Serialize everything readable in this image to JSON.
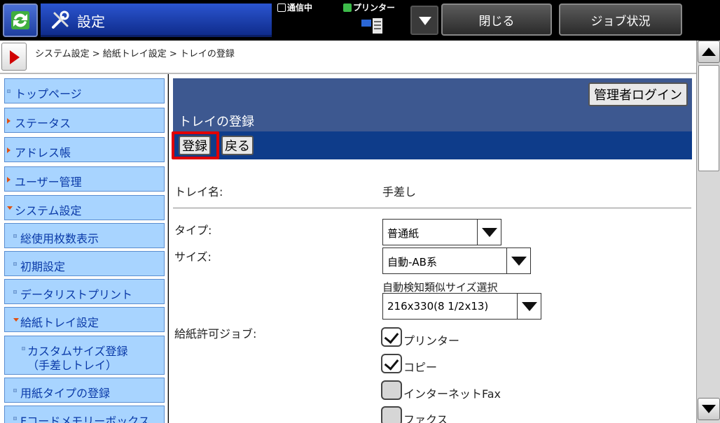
{
  "header": {
    "title": "設定",
    "status_comm": "通信中",
    "status_printer": "プリンター",
    "close_label": "閉じる",
    "job_status_label": "ジョブ状況"
  },
  "breadcrumb": "システム設定 > 給紙トレイ設定 > トレイの登録",
  "sidebar": {
    "items": [
      {
        "label": "トップページ"
      },
      {
        "label": "ステータス"
      },
      {
        "label": "アドレス帳"
      },
      {
        "label": "ユーザー管理"
      },
      {
        "label": "システム設定"
      },
      {
        "label": "総使用枚数表示"
      },
      {
        "label": "初期設定"
      },
      {
        "label": "データリストプリント"
      },
      {
        "label": "給紙トレイ設定"
      },
      {
        "label": "カスタムサイズ登録",
        "label2": "（手差しトレイ）"
      },
      {
        "label": "用紙タイプの登録"
      },
      {
        "label": "Fコードメモリーボックス"
      }
    ]
  },
  "panel": {
    "admin_login": "管理者ログイン",
    "title": "トレイの登録",
    "register": "登録",
    "back": "戻る"
  },
  "form": {
    "tray_name_label": "トレイ名:",
    "tray_name_value": "手差し",
    "type_label": "タイプ:",
    "type_value": "普通紙",
    "size_label": "サイズ:",
    "size_value": "自動-AB系",
    "auto_detect_label": "自動検知類似サイズ選択",
    "auto_detect_value": "216x330(8 1/2x13)",
    "jobs_label": "給紙許可ジョブ:",
    "jobs": [
      {
        "label": "プリンター",
        "checked": true
      },
      {
        "label": "コピー",
        "checked": true
      },
      {
        "label": "インターネットFax",
        "checked": false
      },
      {
        "label": "ファクス",
        "checked": false
      }
    ]
  },
  "colors": {
    "accent_blue": "#0e3c8a",
    "nav_bg": "#a8d4ff",
    "highlight_red": "#e00000"
  }
}
